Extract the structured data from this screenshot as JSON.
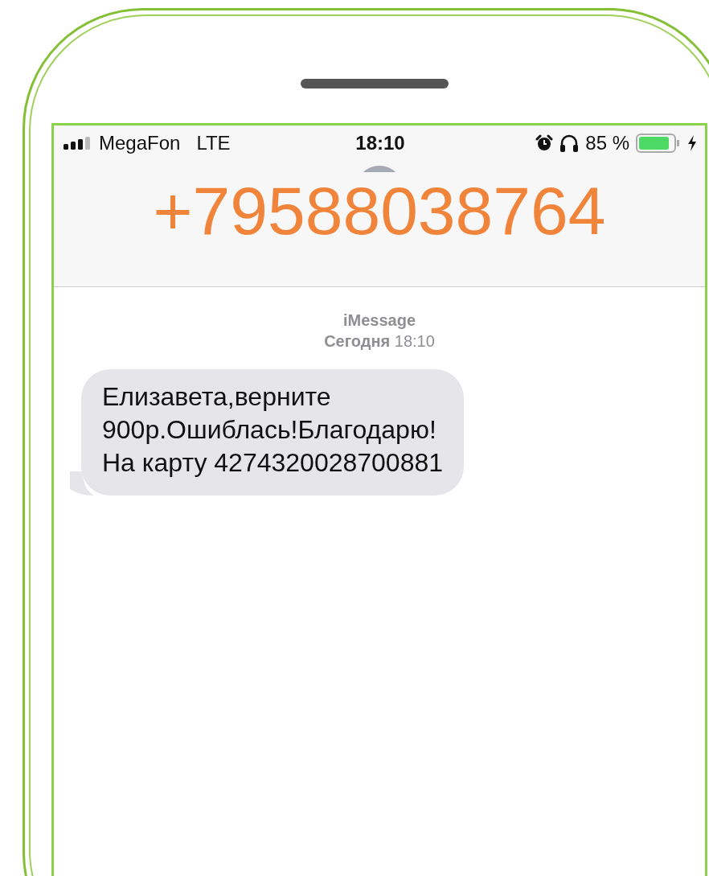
{
  "status_bar": {
    "carrier": "MegaFon",
    "network": "LTE",
    "time": "18:10",
    "battery_percent": "85 %"
  },
  "header": {
    "title": "+79588038764"
  },
  "conversation": {
    "service": "iMessage",
    "timestamp": "**Сегодня** 18:10",
    "messages": [
      {
        "kind": "incoming",
        "text": "Елизавета,верните\n900р.Ошиблась!Благодарю!\nНа карту 4274320028700881"
      }
    ]
  }
}
